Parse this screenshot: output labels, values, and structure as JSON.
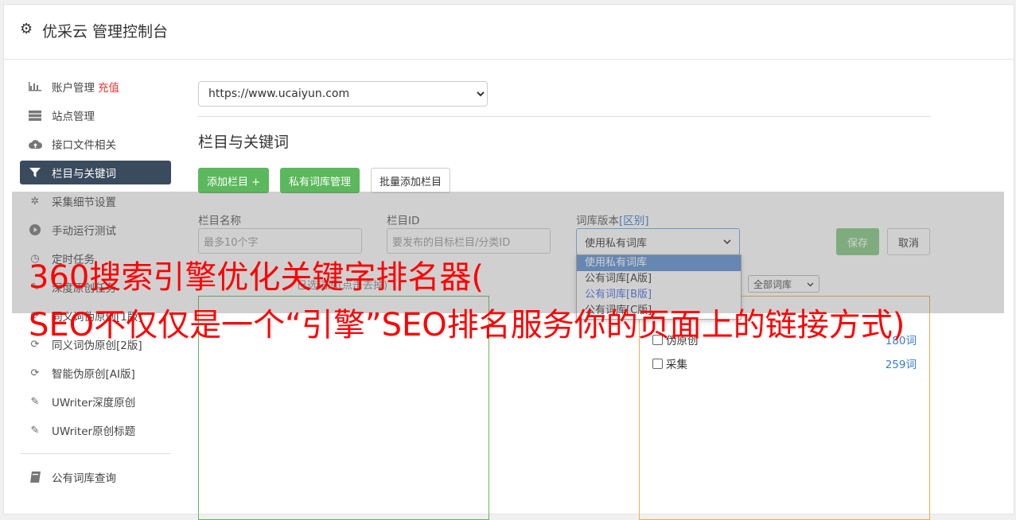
{
  "header": {
    "title": "优采云 管理控制台"
  },
  "sidebar": {
    "items": [
      {
        "label": "账户管理",
        "icon": "bar-chart-icon",
        "badge": "充值"
      },
      {
        "label": "站点管理",
        "icon": "server-icon"
      },
      {
        "label": "接口文件相关",
        "icon": "cloud-upload-icon"
      },
      {
        "label": "栏目与关键词",
        "icon": "filter-icon",
        "active": true
      },
      {
        "label": "采集细节设置",
        "icon": "cogs-icon"
      },
      {
        "label": "手动运行测试",
        "icon": "play-circle-icon"
      },
      {
        "label": "定时任务",
        "icon": "clock-icon"
      },
      {
        "label": "深度原创任务",
        "icon": "edit-icon"
      },
      {
        "label": "同义词伪原创[1版]",
        "icon": "refresh-icon"
      },
      {
        "label": "同义词伪原创[2版]",
        "icon": "refresh-icon"
      },
      {
        "label": "智能伪原创[AI版]",
        "icon": "refresh-icon"
      },
      {
        "label": "UWriter深度原创",
        "icon": "edit-icon"
      },
      {
        "label": "UWriter原创标题",
        "icon": "edit-icon"
      }
    ],
    "bottom_items": [
      {
        "label": "公有词库查询",
        "icon": "book-icon"
      }
    ]
  },
  "main": {
    "site_select": {
      "value": "https://www.ucaiyun.com"
    },
    "section_title": "栏目与关键词",
    "buttons": {
      "add_column": "添加栏目 +",
      "private_dict": "私有词库管理",
      "batch_add": "批量添加栏目"
    },
    "form": {
      "column_name_label": "栏目名称",
      "column_name_placeholder": "最多10个字",
      "column_id_label": "栏目ID",
      "column_id_placeholder": "要发布的目标栏目/分类ID",
      "dict_version_label": "词库版本",
      "dict_version_link": "[区别]",
      "dict_version_value": "使用私有词库",
      "save": "保存",
      "cancel": "取消"
    },
    "dropdown_options": [
      {
        "label": "使用私有词库",
        "selected": true
      },
      {
        "label": "公有词库[A版]"
      },
      {
        "label": "公有词库[B版]",
        "blue": true
      },
      {
        "label": "公有词库[C版]"
      }
    ],
    "left_hint": "已选词库(点击去掉)",
    "lib_filter": "全部词库",
    "lib_rows": [
      {
        "label": "伪原创",
        "count": "180词"
      },
      {
        "label": "采集",
        "count": "259词"
      }
    ]
  },
  "ad_overlay": {
    "line1": "360搜索引擎优化关键字排名器(",
    "line2": "SEO不仅仅是一个“引擎”SEO排名服务你的页面上的链接方式)"
  }
}
